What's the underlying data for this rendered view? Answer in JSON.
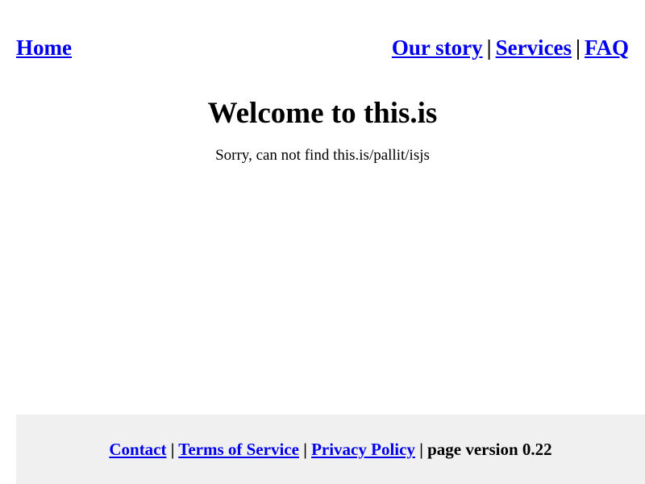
{
  "nav": {
    "home": "Home",
    "our_story": "Our story",
    "services": "Services",
    "faq": "FAQ",
    "separator": "|"
  },
  "main": {
    "title": "Welcome to this.is",
    "message": "Sorry, can not find this.is/pallit/isjs"
  },
  "footer": {
    "contact": "Contact",
    "terms": "Terms of Service",
    "privacy": "Privacy Policy",
    "separator": "|",
    "version": "page version 0.22"
  },
  "colors": {
    "link": "#0000ee",
    "footer_background": "#f0f0f0"
  }
}
